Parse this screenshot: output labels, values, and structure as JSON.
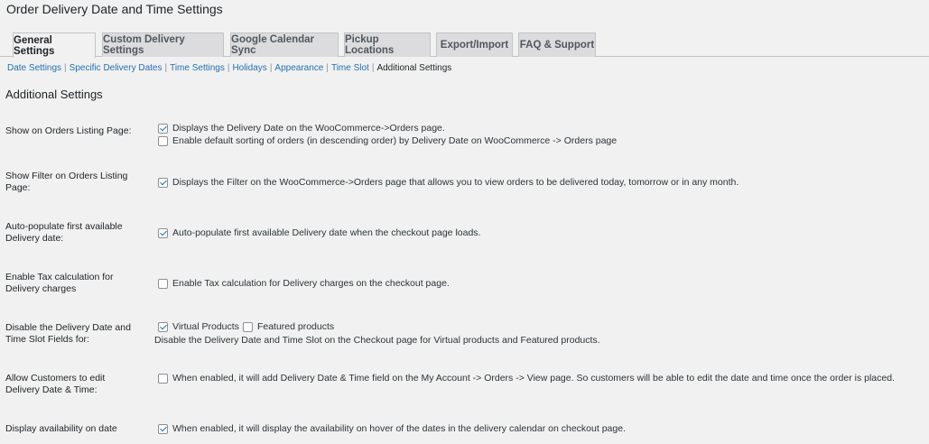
{
  "page_title": "Order Delivery Date and Time Settings",
  "tabs": [
    {
      "label": "General Settings",
      "active": true
    },
    {
      "label": "Custom Delivery Settings",
      "active": false
    },
    {
      "label": "Google Calendar Sync",
      "active": false
    },
    {
      "label": "Pickup Locations",
      "active": false
    },
    {
      "label": "Export/Import",
      "active": false
    },
    {
      "label": "FAQ & Support",
      "active": false
    }
  ],
  "subnav": [
    {
      "label": "Date Settings"
    },
    {
      "label": "Specific Delivery Dates"
    },
    {
      "label": "Time Settings"
    },
    {
      "label": "Holidays"
    },
    {
      "label": "Appearance"
    },
    {
      "label": "Time Slot"
    },
    {
      "label": "Additional Settings",
      "current": true
    }
  ],
  "subnav_separator": "|",
  "section_title": "Additional Settings",
  "settings": {
    "orders_listing": {
      "label": "Show on Orders Listing Page:",
      "options": [
        {
          "text": "Displays the Delivery Date on the WooCommerce->Orders page.",
          "checked": true
        },
        {
          "text": "Enable default sorting of orders (in descending order) by Delivery Date on WooCommerce -> Orders page",
          "checked": false
        }
      ]
    },
    "filter_listing": {
      "label_line1": "Show Filter on Orders Listing",
      "label_line2": "Page:",
      "options": [
        {
          "text": "Displays the Filter on the WooCommerce->Orders page that allows you to view orders to be delivered today, tomorrow or in any month.",
          "checked": true
        }
      ]
    },
    "auto_populate": {
      "label_line1": "Auto-populate first available",
      "label_line2": "Delivery date:",
      "options": [
        {
          "text": "Auto-populate first available Delivery date when the checkout page loads.",
          "checked": true
        }
      ]
    },
    "tax_calc": {
      "label_line1": "Enable Tax calculation for",
      "label_line2": "Delivery charges",
      "options": [
        {
          "text": "Enable Tax calculation for Delivery charges on the checkout page.",
          "checked": false
        }
      ]
    },
    "disable_fields": {
      "label_line1": "Disable the Delivery Date and",
      "label_line2": "Time Slot Fields for:",
      "options": [
        {
          "text": "Virtual Products",
          "checked": true
        },
        {
          "text": "Featured products",
          "checked": false
        }
      ],
      "description": "Disable the Delivery Date and Time Slot on the Checkout page for Virtual products and Featured products."
    },
    "customer_edit": {
      "label_line1": "Allow Customers to edit",
      "label_line2": "Delivery Date & Time:",
      "options": [
        {
          "text": "When enabled, it will add Delivery Date & Time field on the My Account -> Orders -> View page. So customers will be able to edit the date and time once the order is placed.",
          "checked": false
        }
      ]
    },
    "availability": {
      "label": "Display availability on date",
      "options": [
        {
          "text": "When enabled, it will display the availability on hover of the dates in the delivery calendar on checkout page.",
          "checked": true
        }
      ]
    }
  }
}
